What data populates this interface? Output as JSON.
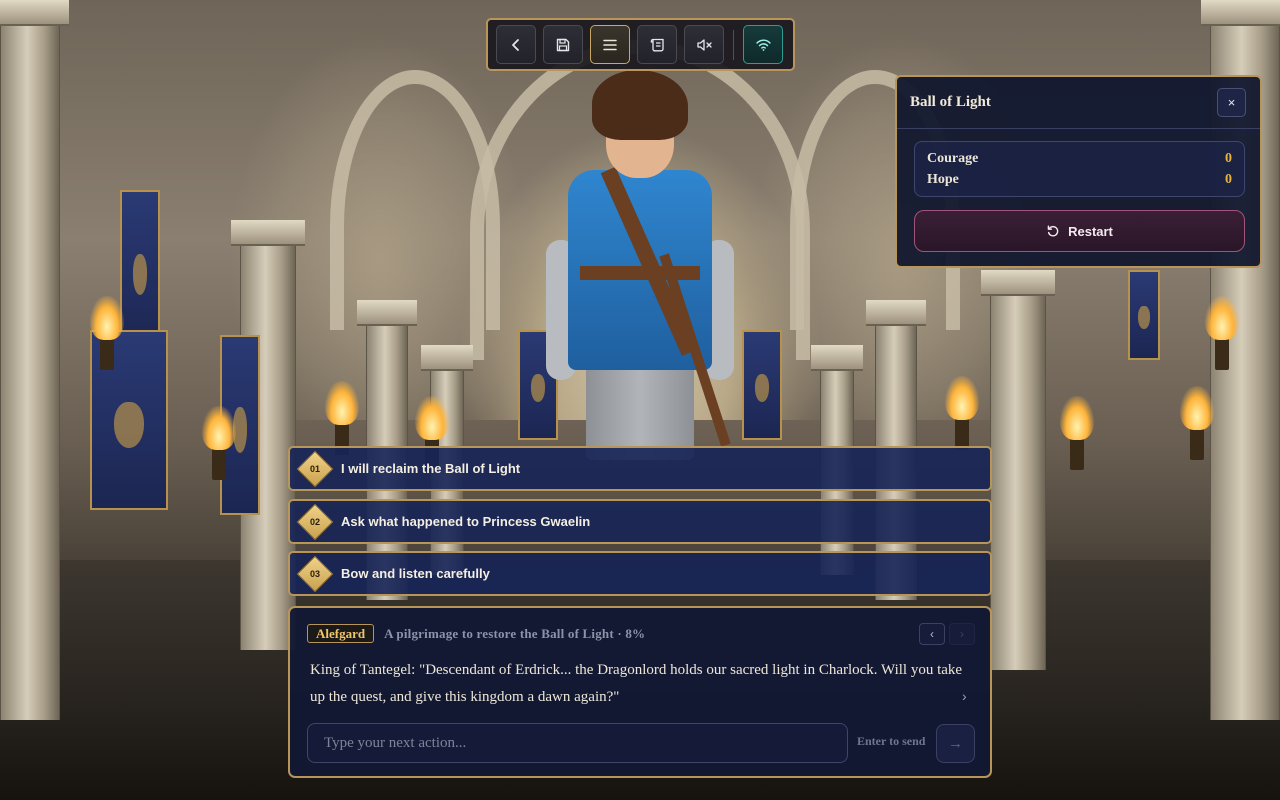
{
  "toolbar": {
    "buttons": [
      {
        "name": "back",
        "icon": "chevron-left-icon"
      },
      {
        "name": "save",
        "icon": "save-icon"
      },
      {
        "name": "menu",
        "icon": "menu-icon",
        "active": true
      },
      {
        "name": "log",
        "icon": "scroll-icon"
      },
      {
        "name": "mute",
        "icon": "volume-mute-icon"
      },
      {
        "name": "network",
        "icon": "wifi-icon",
        "status": "connected"
      }
    ]
  },
  "stats_panel": {
    "title": "Ball of Light",
    "close_label": "×",
    "stats": [
      {
        "label": "Courage",
        "value": "0"
      },
      {
        "label": "Hope",
        "value": "0"
      }
    ],
    "restart_label": "Restart"
  },
  "choices": [
    {
      "num": "01",
      "label": "I will reclaim the Ball of Light"
    },
    {
      "num": "02",
      "label": "Ask what happened to Princess Gwaelin"
    },
    {
      "num": "03",
      "label": "Bow and listen carefully"
    }
  ],
  "dialog": {
    "location": "Alefgard",
    "subtitle": "A pilgrimage to restore the Ball of Light · 8%",
    "progress_percent": 8,
    "text": "King of Tantegel: \"Descendant of Erdrick... the Dragonlord holds our sacred light in Charlock. Will you take up the quest, and give this kingdom a dawn again?\"",
    "prev_label": "‹",
    "next_label": "›",
    "more_label": "›",
    "input_placeholder": "Type your next action...",
    "input_value": "",
    "send_hint": "Enter to send",
    "send_label": "→"
  },
  "colors": {
    "accent_gold": "#b8965a",
    "panel_navy": "#121834",
    "stat_value": "#e9b43a",
    "restart_border": "#a1547a",
    "network_teal": "#2f9b95"
  }
}
